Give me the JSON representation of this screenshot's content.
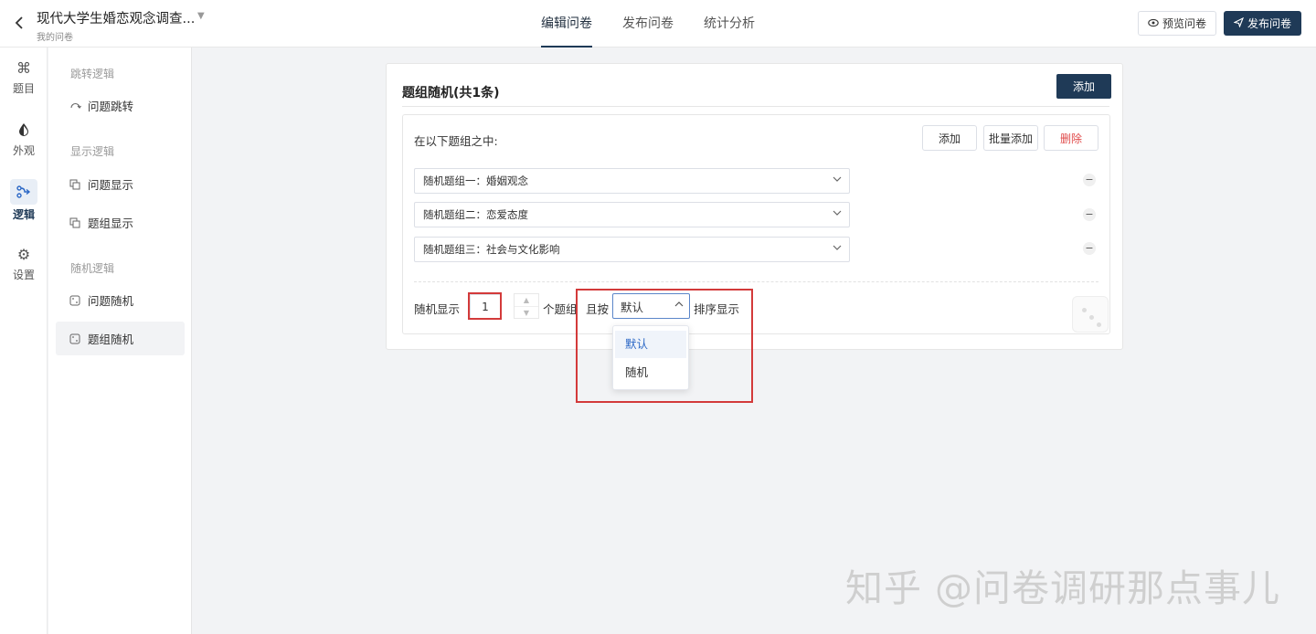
{
  "header": {
    "title": "现代大学生婚恋观念调查...",
    "subtitle": "我的问卷",
    "tabs": [
      {
        "label": "编辑问卷",
        "active": true
      },
      {
        "label": "发布问卷",
        "active": false
      },
      {
        "label": "统计分析",
        "active": false
      }
    ],
    "preview_label": "预览问卷",
    "publish_label": "发布问卷"
  },
  "nav": {
    "items": [
      {
        "label": "题目",
        "icon": "command-icon"
      },
      {
        "label": "外观",
        "icon": "drop-icon"
      },
      {
        "label": "逻辑",
        "icon": "logic-icon",
        "active": true
      },
      {
        "label": "设置",
        "icon": "gear-icon"
      }
    ]
  },
  "submenu": {
    "sections": [
      {
        "label": "跳转逻辑",
        "items": [
          {
            "label": "问题跳转"
          }
        ]
      },
      {
        "label": "显示逻辑",
        "items": [
          {
            "label": "问题显示"
          },
          {
            "label": "题组显示"
          }
        ]
      },
      {
        "label": "随机逻辑",
        "items": [
          {
            "label": "问题随机"
          },
          {
            "label": "题组随机",
            "active": true
          }
        ]
      }
    ]
  },
  "card": {
    "title": "题组随机(共1条)",
    "add_label": "添加",
    "inner_label": "在以下题组之中:",
    "add_btn": "添加",
    "batch_add_btn": "批量添加",
    "delete_btn": "删除",
    "groups": [
      {
        "label": "随机题组一：婚姻观念"
      },
      {
        "label": "随机题组二：恋爱态度"
      },
      {
        "label": "随机题组三：社会与文化影响"
      }
    ],
    "show_prefix": "随机显示",
    "count": "1",
    "count_suffix": "个题组",
    "order_prefix": "且按",
    "order_value": "默认",
    "order_suffix": "排序显示",
    "order_options": [
      {
        "label": "默认",
        "selected": true
      },
      {
        "label": "随机",
        "selected": false
      }
    ]
  },
  "watermark": "知乎 @问卷调研那点事儿",
  "colors": {
    "primary": "#1f3a57",
    "highlight": "#d33a3a",
    "accent": "#2c68c6"
  }
}
